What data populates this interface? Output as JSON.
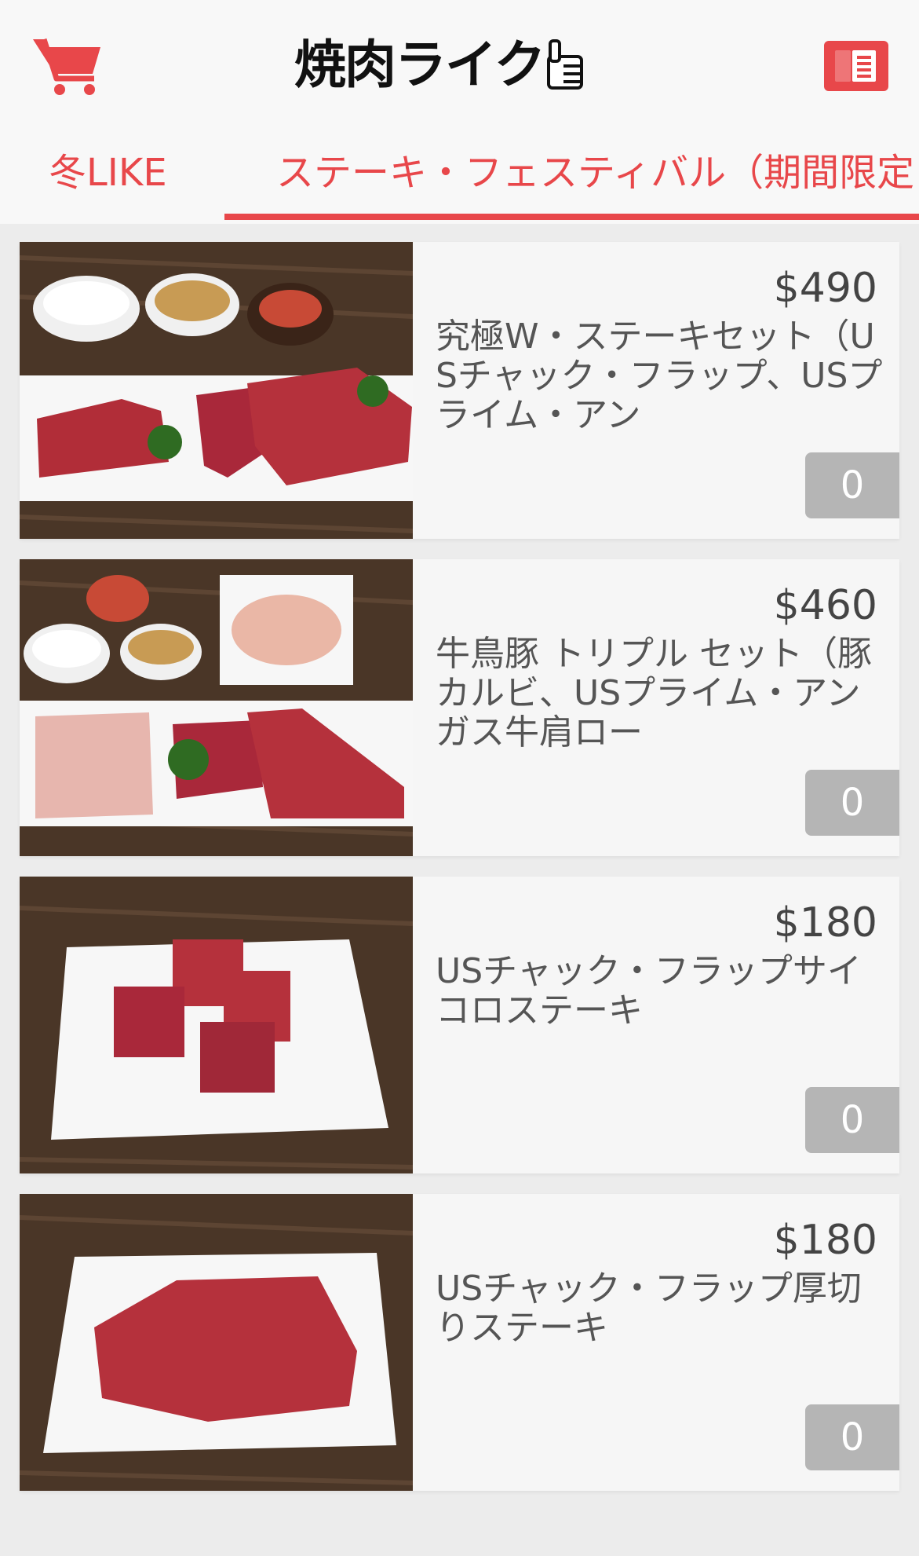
{
  "header": {
    "logo_text": "焼肉ライク",
    "cart_icon": "shopping-cart-icon",
    "menu_icon": "menu-list-icon",
    "accent_color": "#e8474a"
  },
  "tabs": [
    {
      "label": "冬LIKE"
    },
    {
      "label": "ステーキ・フェスティバル（期間限定"
    }
  ],
  "items": [
    {
      "price": "$490",
      "name": "究極W・ステーキセット（USチャック・フラップ、USプライム・アン",
      "qty": "0",
      "image": "steak-set-image"
    },
    {
      "price": "$460",
      "name": "牛鳥豚 トリプル セット（豚カルビ、USプライム・アンガス牛肩ロー",
      "qty": "0",
      "image": "triple-set-image"
    },
    {
      "price": "$180",
      "name": "USチャック・フラップサイコロステーキ",
      "qty": "0",
      "image": "dice-steak-image"
    },
    {
      "price": "$180",
      "name": "USチャック・フラップ厚切りステーキ",
      "qty": "0",
      "image": "thick-steak-image"
    }
  ]
}
